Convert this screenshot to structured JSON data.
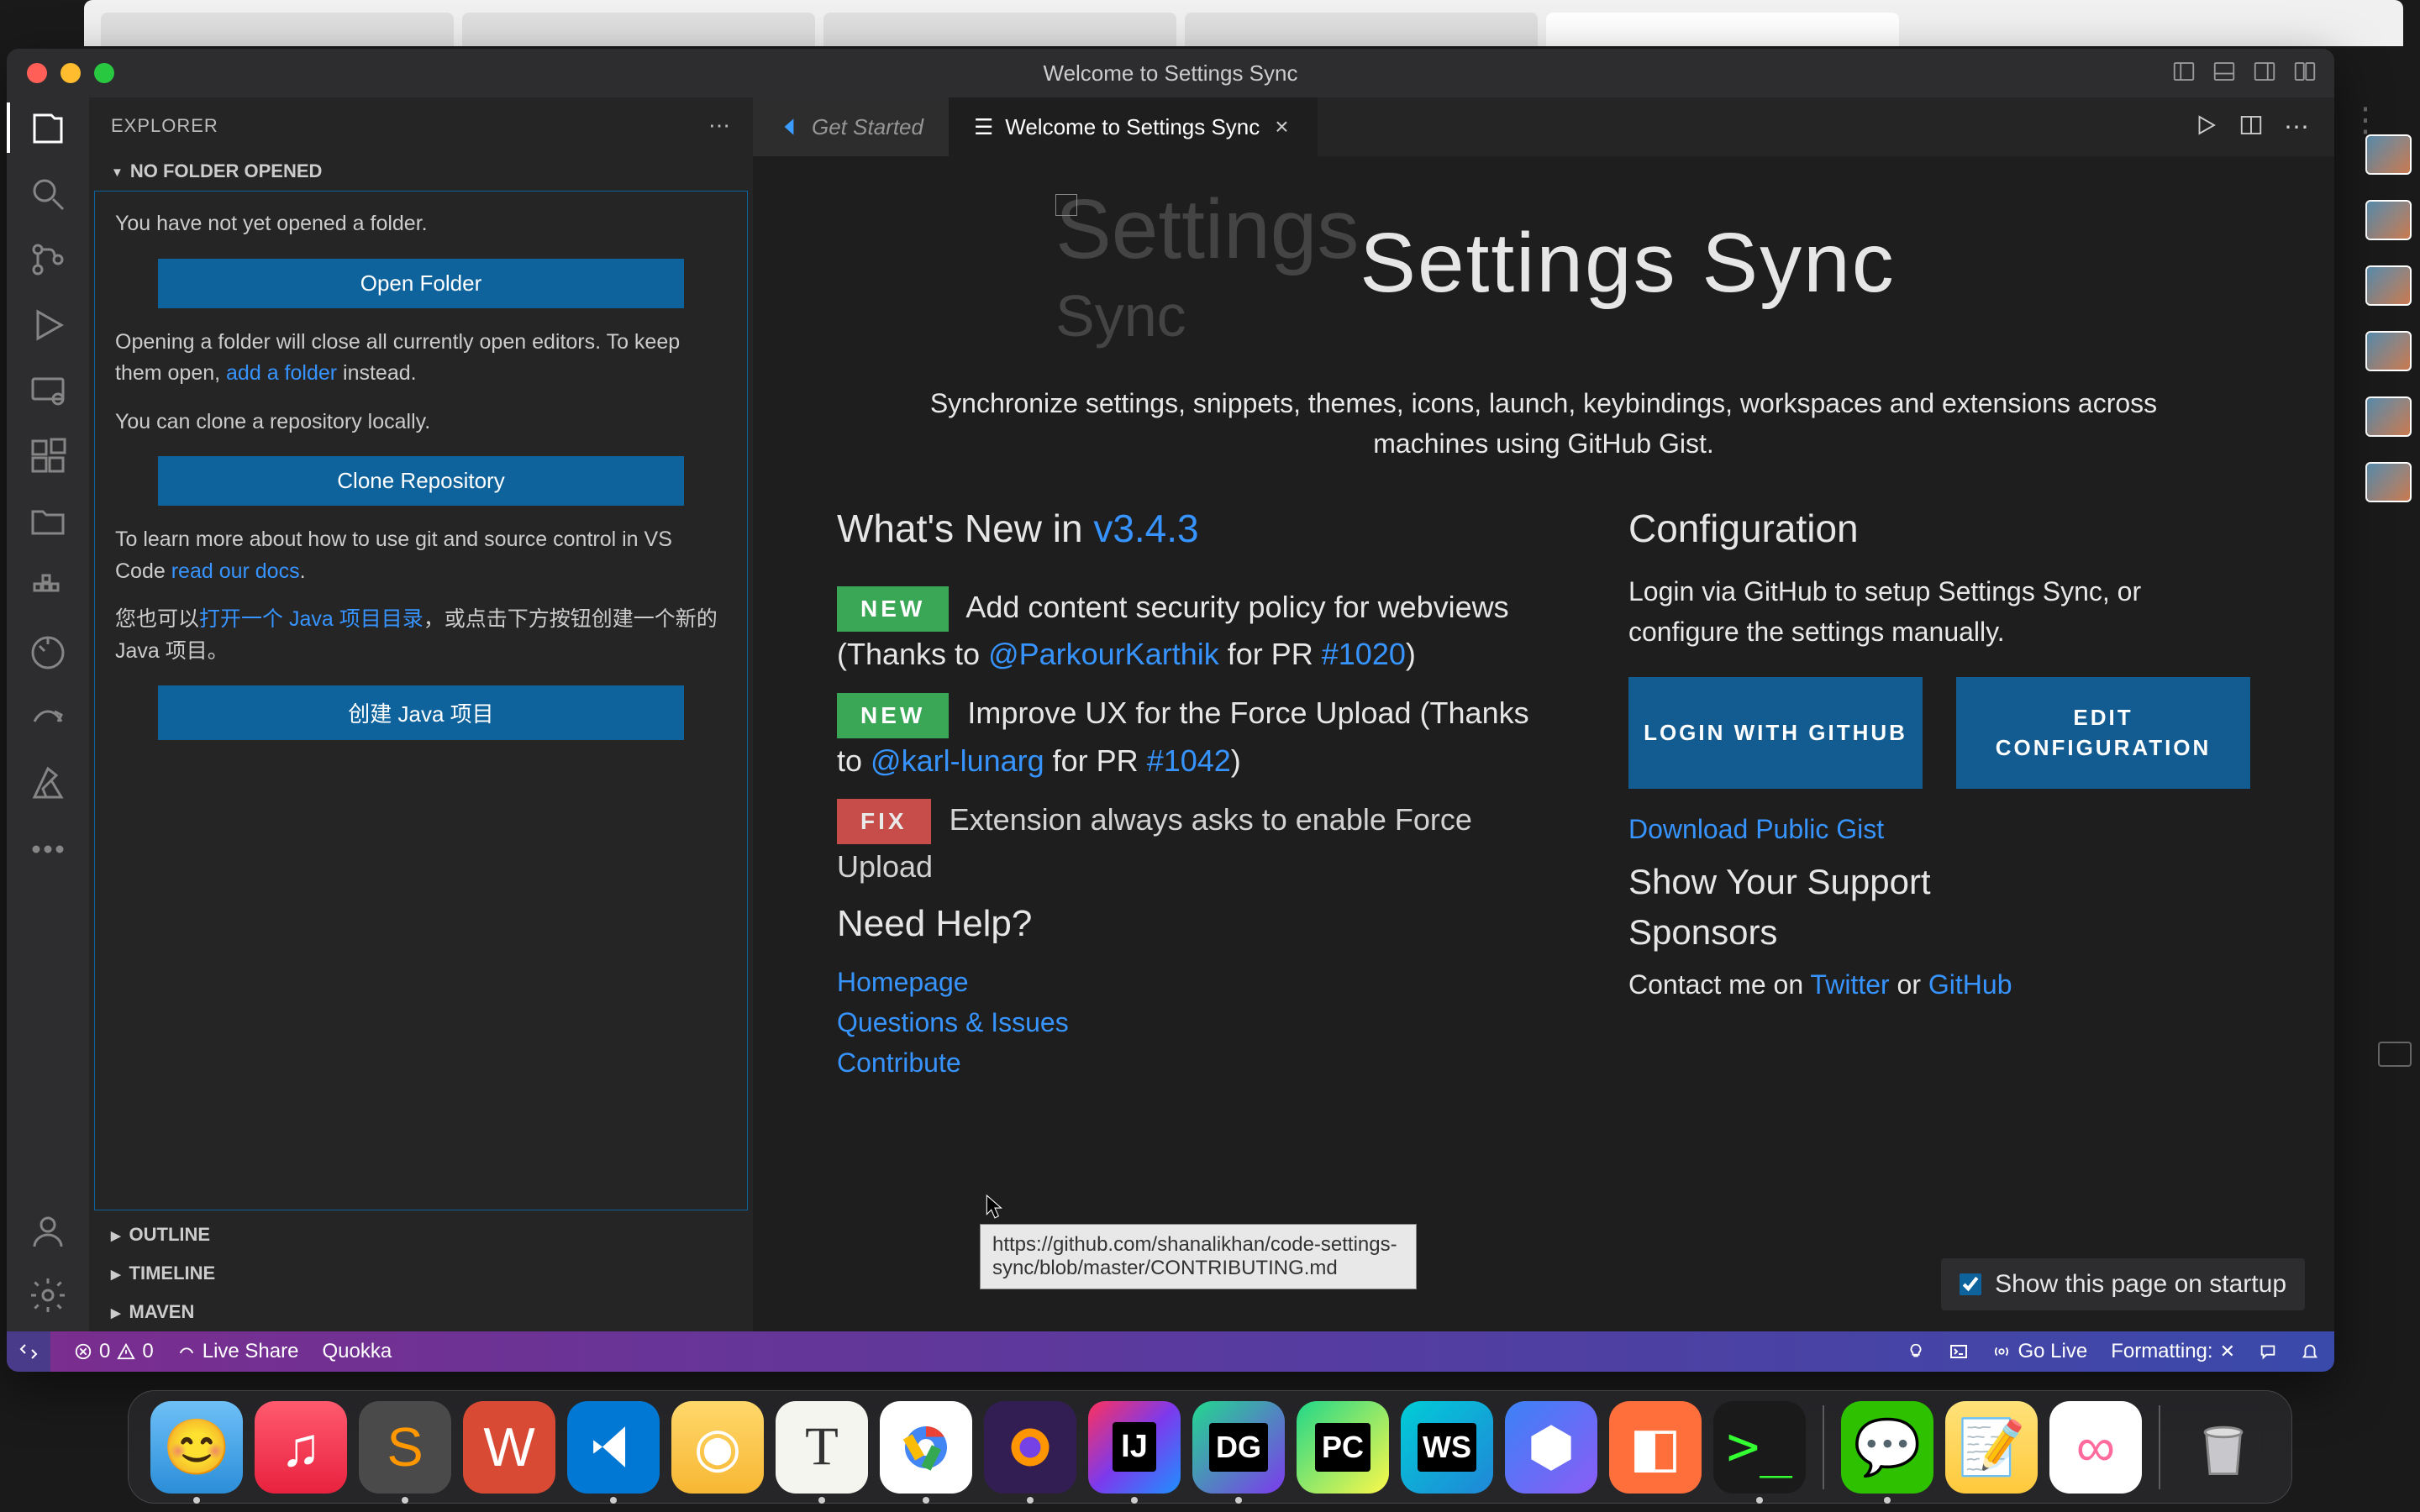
{
  "bg": {},
  "window": {
    "title": "Welcome to Settings Sync"
  },
  "sidebar": {
    "header": "EXPLORER",
    "section": "NO FOLDER OPENED",
    "no_folder_msg": "You have not yet opened a folder.",
    "open_folder_btn": "Open Folder",
    "opening_msg_pre": "Opening a folder will close all currently open editors. To keep them open, ",
    "add_folder_link": "add a folder",
    "opening_msg_post": " instead.",
    "clone_msg": "You can clone a repository locally.",
    "clone_btn": "Clone Repository",
    "learn_pre": "To learn more about how to use git and source control in VS Code ",
    "read_docs": "read our docs",
    "learn_post": ".",
    "java_pre": "您也可以",
    "java_link": "打开一个 Java 项目目录",
    "java_post": "，或点击下方按钮创建一个新的 Java 项目。",
    "create_java_btn": "创建 Java 项目",
    "outline": "OUTLINE",
    "timeline": "TIMELINE",
    "maven": "MAVEN"
  },
  "tabs": {
    "get_started": "Get Started",
    "settings_sync": "Welcome to Settings Sync"
  },
  "content": {
    "title": "Settings Sync",
    "ghost": "Settings",
    "ghost2": "Sync",
    "desc": "Synchronize settings, snippets, themes, icons, launch, keybindings, workspaces and extensions across machines using GitHub Gist.",
    "whatsnew_label": "What's New in ",
    "version": "v3.4.3",
    "badge_new": "NEW",
    "badge_fix": "FIX",
    "news1_a": " Add content security policy for webviews (Thanks to ",
    "news1_user": "@ParkourKarthik",
    "news1_b": " for PR ",
    "news1_pr": "#1020",
    "news1_c": ")",
    "news2_a": " Improve UX for the Force Upload (Thanks to ",
    "news2_user": "@karl-lunarg",
    "news2_b": " for PR ",
    "news2_pr": "#1042",
    "news2_c": ")",
    "news3_a": " Extension always asks to enable Force Upload",
    "need_help": "Need Help?",
    "help_home": "Homepage",
    "help_qi": "Questions & Issues",
    "help_contrib": "Contribute",
    "config_title": "Configuration",
    "config_text": "Login via GitHub to setup Settings Sync, or configure the settings manually.",
    "login_btn": "LOGIN WITH GITHUB",
    "edit_btn": "EDIT CONFIGURATION",
    "dl_gist": "Download Public Gist",
    "support_title": "Show Your Support",
    "sponsors_title": "Sponsors",
    "contact_pre": "Contact me on ",
    "twitter": "Twitter",
    "contact_or": " or ",
    "github": "GitHub",
    "startup": "Show this page on startup",
    "tooltip": "https://github.com/shanalikhan/code-settings-sync/blob/master/CONTRIBUTING.md"
  },
  "statusbar": {
    "errors": "0",
    "warnings": "0",
    "liveshare": "Live Share",
    "quokka": "Quokka",
    "golive": "Go Live",
    "formatting": "Formatting: "
  }
}
